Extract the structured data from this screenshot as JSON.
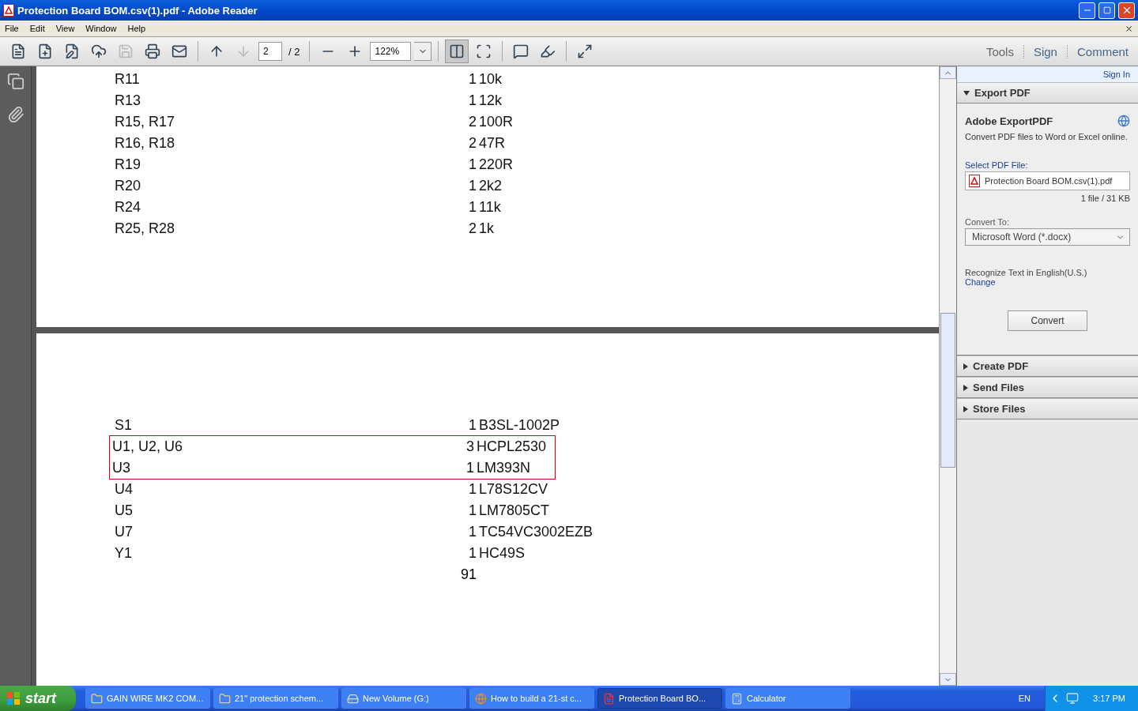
{
  "window": {
    "title": "Protection Board BOM.csv(1).pdf - Adobe Reader"
  },
  "menu": [
    "File",
    "Edit",
    "View",
    "Window",
    "Help"
  ],
  "toolbar": {
    "buttons": [
      {
        "kind": "create",
        "disabled": false
      },
      {
        "kind": "createpdf",
        "disabled": false
      },
      {
        "kind": "edit",
        "disabled": false
      },
      {
        "kind": "upload",
        "disabled": false
      },
      {
        "kind": "save",
        "disabled": true
      },
      {
        "kind": "print",
        "disabled": false
      },
      {
        "kind": "mail",
        "disabled": false
      },
      {
        "kind": "prev",
        "disabled": false
      },
      {
        "kind": "next",
        "disabled": true
      }
    ],
    "page_field": {
      "value": "2"
    },
    "page_total": "/ 2",
    "zoom_buttons": [
      {
        "kind": "zoomout"
      },
      {
        "kind": "zoomin"
      }
    ],
    "zoom_field": {
      "value": "122%"
    },
    "view_buttons": [
      {
        "kind": "fitpage",
        "selected": true
      },
      {
        "kind": "fitwidth",
        "selected": false
      },
      {
        "kind": "comment",
        "selected": false
      },
      {
        "kind": "highlight",
        "selected": false
      },
      {
        "kind": "fullscreen",
        "selected": false
      }
    ],
    "tabs": [
      "Tools",
      "Sign",
      "Comment"
    ]
  },
  "pages": [
    {
      "rows": [
        {
          "ref": "R11",
          "qty": "1",
          "value": "10k",
          "highlighted": false
        },
        {
          "ref": "R13",
          "qty": "1",
          "value": "12k",
          "highlighted": false
        },
        {
          "ref": "R15, R17",
          "qty": "2",
          "value": "100R",
          "highlighted": false
        },
        {
          "ref": "R16, R18",
          "qty": "2",
          "value": "47R",
          "highlighted": false
        },
        {
          "ref": "R19",
          "qty": "1",
          "value": "220R",
          "highlighted": false
        },
        {
          "ref": "R20",
          "qty": "1",
          "value": "2k2",
          "highlighted": false
        },
        {
          "ref": "R24",
          "qty": "1",
          "value": "11k",
          "highlighted": false
        },
        {
          "ref": "R25, R28",
          "qty": "2",
          "value": "1k",
          "highlighted": false
        }
      ]
    },
    {
      "rows": [
        {
          "ref": "S1",
          "qty": "1",
          "value": "B3SL-1002P",
          "highlighted": false
        },
        {
          "ref": "U1, U2, U6",
          "qty": "3",
          "value": "HCPL2530",
          "highlighted": true
        },
        {
          "ref": "U3",
          "qty": "1",
          "value": "LM393N",
          "highlighted": true
        },
        {
          "ref": "U4",
          "qty": "1",
          "value": "L78S12CV",
          "highlighted": false
        },
        {
          "ref": "U5",
          "qty": "1",
          "value": "LM7805CT",
          "highlighted": false
        },
        {
          "ref": "U7",
          "qty": "1",
          "value": "TC54VC3002EZB",
          "highlighted": false
        },
        {
          "ref": "Y1",
          "qty": "1",
          "value": "HC49S",
          "highlighted": false
        }
      ],
      "total": "91"
    }
  ],
  "panel": {
    "sign_in": "Sign In",
    "export": {
      "header": "Export PDF",
      "expanded": true,
      "title": "Adobe ExportPDF",
      "description": "Convert PDF files to Word or Excel online.",
      "select_label": "Select PDF File:",
      "file": "Protection Board BOM.csv(1).pdf",
      "file_info": "1 file / 31 KB",
      "convert_label": "Convert To:",
      "format": "Microsoft Word (*.docx)",
      "recognize": "Recognize Text in English(U.S.)",
      "change": "Change",
      "button": "Convert"
    },
    "sections": [
      {
        "header": "Create PDF",
        "expanded": false
      },
      {
        "header": "Send Files",
        "expanded": false
      },
      {
        "header": "Store Files",
        "expanded": false
      }
    ]
  },
  "taskbar": {
    "start": "start",
    "items": [
      {
        "kind": "folder",
        "label": "GAIN WIRE MK2 COM...",
        "selected": false
      },
      {
        "kind": "folder",
        "label": "21\" protection schem...",
        "selected": false
      },
      {
        "kind": "drive",
        "label": "New Volume (G:)",
        "selected": false
      },
      {
        "kind": "browser",
        "label": "How to build a 21-st c...",
        "selected": false
      },
      {
        "kind": "pdf",
        "label": "Protection Board BO...",
        "selected": true
      },
      {
        "kind": "calculator",
        "label": "Calculator",
        "selected": false
      }
    ],
    "language": "EN",
    "clock": "3:17 PM"
  }
}
